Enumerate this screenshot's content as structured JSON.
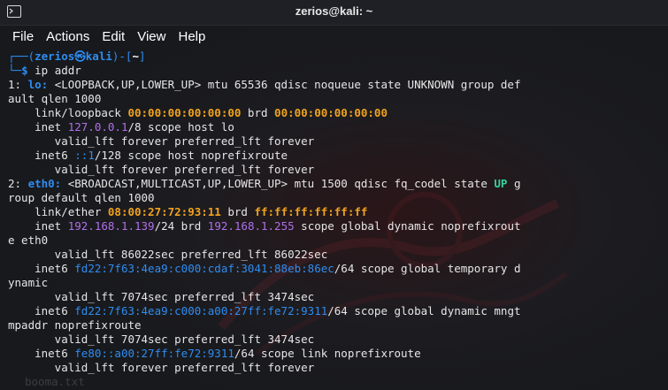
{
  "window": {
    "title": "zerios@kali: ~"
  },
  "menu": [
    "File",
    "Actions",
    "Edit",
    "View",
    "Help"
  ],
  "background_ghost_text": "booma.txt",
  "colors": {
    "address": "#2f8cf0",
    "interface": "#2f8cf0",
    "state_up": "#36d39b",
    "mac": "#f0a31e",
    "ipv4": "#b070e8"
  },
  "terminal": {
    "lines": [
      [
        {
          "t": "┌──(",
          "c": "blue"
        },
        {
          "t": "zerios㉿kali",
          "c": "user-b"
        },
        {
          "t": ")-[",
          "c": "blue"
        },
        {
          "t": "~",
          "c": "white-b"
        },
        {
          "t": "]",
          "c": "blue"
        }
      ],
      [
        {
          "t": "└─",
          "c": "blue"
        },
        {
          "t": "$ ",
          "c": "blue-b"
        },
        {
          "t": "ip addr",
          "c": ""
        }
      ],
      [
        {
          "t": "1: ",
          "c": ""
        },
        {
          "t": "lo: ",
          "c": "blue-b"
        },
        {
          "t": "<LOOPBACK,UP,LOWER_UP> mtu 65536 qdisc noqueue state UNKNOWN group def",
          "c": ""
        }
      ],
      [
        {
          "t": "ault qlen 1000",
          "c": ""
        }
      ],
      [
        {
          "t": "    link/loopback ",
          "c": ""
        },
        {
          "t": "00:00:00:00:00:00",
          "c": "orange-b"
        },
        {
          "t": " brd ",
          "c": ""
        },
        {
          "t": "00:00:00:00:00:00",
          "c": "orange-b"
        }
      ],
      [
        {
          "t": "    inet ",
          "c": ""
        },
        {
          "t": "127.0.0.1",
          "c": "purple"
        },
        {
          "t": "/8 scope host lo",
          "c": ""
        }
      ],
      [
        {
          "t": "       valid_lft forever preferred_lft forever",
          "c": ""
        }
      ],
      [
        {
          "t": "    inet6 ",
          "c": ""
        },
        {
          "t": "::1",
          "c": "blue"
        },
        {
          "t": "/128 scope host noprefixroute",
          "c": ""
        }
      ],
      [
        {
          "t": "       valid_lft forever preferred_lft forever",
          "c": ""
        }
      ],
      [
        {
          "t": "2: ",
          "c": ""
        },
        {
          "t": "eth0: ",
          "c": "blue-b"
        },
        {
          "t": "<BROADCAST,MULTICAST,UP,LOWER_UP> mtu 1500 qdisc fq_codel state ",
          "c": ""
        },
        {
          "t": "UP",
          "c": "green-b"
        },
        {
          "t": " g",
          "c": ""
        }
      ],
      [
        {
          "t": "roup default qlen 1000",
          "c": ""
        }
      ],
      [
        {
          "t": "    link/ether ",
          "c": ""
        },
        {
          "t": "08:00:27:72:93:11",
          "c": "orange-b"
        },
        {
          "t": " brd ",
          "c": ""
        },
        {
          "t": "ff:ff:ff:ff:ff:ff",
          "c": "orange-b"
        }
      ],
      [
        {
          "t": "    inet ",
          "c": ""
        },
        {
          "t": "192.168.1.139",
          "c": "purple"
        },
        {
          "t": "/24 brd ",
          "c": ""
        },
        {
          "t": "192.168.1.255",
          "c": "purple"
        },
        {
          "t": " scope global dynamic noprefixrout",
          "c": ""
        }
      ],
      [
        {
          "t": "e eth0",
          "c": ""
        }
      ],
      [
        {
          "t": "       valid_lft 86022sec preferred_lft 86022sec",
          "c": ""
        }
      ],
      [
        {
          "t": "    inet6 ",
          "c": ""
        },
        {
          "t": "fd22:7f63:4ea9:c000:cdaf:3041:88eb:86ec",
          "c": "blue"
        },
        {
          "t": "/64 scope global temporary d",
          "c": ""
        }
      ],
      [
        {
          "t": "ynamic",
          "c": ""
        }
      ],
      [
        {
          "t": "       valid_lft 7074sec preferred_lft 3474sec",
          "c": ""
        }
      ],
      [
        {
          "t": "    inet6 ",
          "c": ""
        },
        {
          "t": "fd22:7f63:4ea9:c000:a00:27ff:fe72:9311",
          "c": "blue"
        },
        {
          "t": "/64 scope global dynamic mngt",
          "c": ""
        }
      ],
      [
        {
          "t": "mpaddr noprefixroute",
          "c": ""
        }
      ],
      [
        {
          "t": "       valid_lft 7074sec preferred_lft 3474sec",
          "c": ""
        }
      ],
      [
        {
          "t": "    inet6 ",
          "c": ""
        },
        {
          "t": "fe80::a00:27ff:fe72:9311",
          "c": "blue"
        },
        {
          "t": "/64 scope link noprefixroute",
          "c": ""
        }
      ],
      [
        {
          "t": "       valid_lft forever preferred_lft forever",
          "c": ""
        }
      ]
    ]
  }
}
